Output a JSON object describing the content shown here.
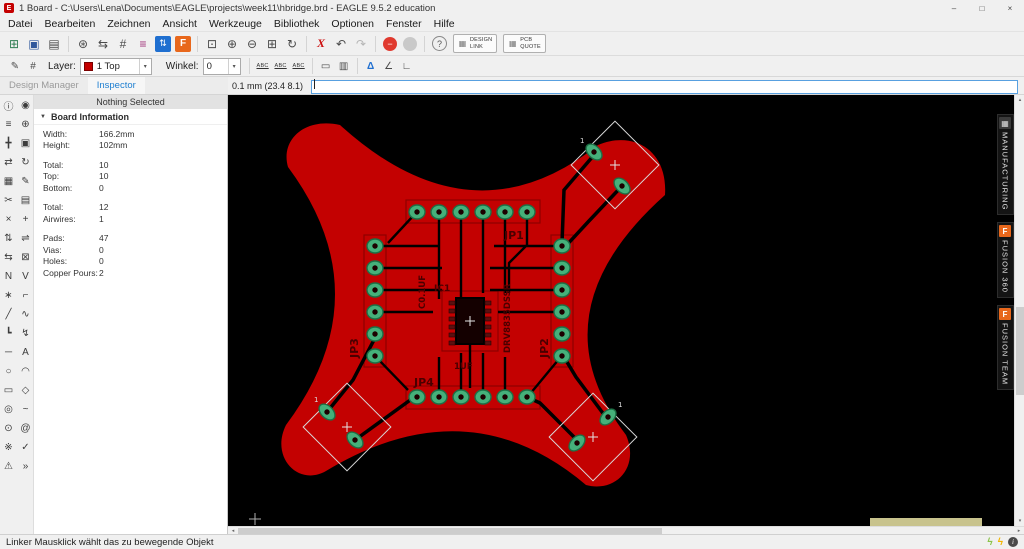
{
  "titlebar": {
    "title": "1 Board - C:\\Users\\Lena\\Documents\\EAGLE\\projects\\week11\\hbridge.brd - EAGLE 9.5.2 education",
    "minimize": "–",
    "maximize": "□",
    "close": "×",
    "app_initial": "E"
  },
  "menubar": {
    "items": [
      "Datei",
      "Bearbeiten",
      "Zeichnen",
      "Ansicht",
      "Werkzeuge",
      "Bibliothek",
      "Optionen",
      "Fenster",
      "Hilfe"
    ]
  },
  "toolbar": {
    "open": "⊞",
    "save": "▣",
    "print": "▤",
    "cam": "⊛",
    "schematic": "⇆",
    "grid": "#",
    "layers": "≡",
    "sync": "⇅",
    "fusion": "F",
    "zoom_fit": "⊡",
    "zoom_in": "⊕",
    "zoom_out": "⊖",
    "zoom_select": "⊞",
    "zoom_redraw": "↻",
    "cancel": "X",
    "undo": "↶",
    "redo": "↷",
    "stop": "−",
    "help": "?",
    "design_link_1": "DESIGN",
    "design_link_2": "LINK",
    "pcb_quote_1": "PCB",
    "pcb_quote_2": "QUOTE",
    "grid_glyph": "▦"
  },
  "parambar": {
    "tool1": "✎",
    "tool2": "#",
    "layer_label": "Layer:",
    "layer_value": "1 Top",
    "angle_label": "Winkel:",
    "angle_value": "0",
    "abc": "ABC",
    "mirror": "▭",
    "spin": "▥",
    "delta": "Δ",
    "angle_icon": "∠",
    "right_angle": "∟",
    "caret": "▾"
  },
  "panel": {
    "tabs": [
      {
        "label": "Design Manager"
      },
      {
        "label": "Inspector"
      }
    ],
    "nothing_selected": "Nothing Selected",
    "section_title": "Board Information",
    "triangle": "▼",
    "rows": [
      {
        "label": "Width:",
        "value": "166.2mm"
      },
      {
        "label": "Height:",
        "value": "102mm"
      },
      {
        "label": "Total:",
        "value": "10"
      },
      {
        "label": "Top:",
        "value": "10"
      },
      {
        "label": "Bottom:",
        "value": "0"
      },
      {
        "label": "Total:",
        "value": "12"
      },
      {
        "label": "Airwires:",
        "value": "1"
      },
      {
        "label": "Pads:",
        "value": "47"
      },
      {
        "label": "Vias:",
        "value": "0"
      },
      {
        "label": "Holes:",
        "value": "0"
      },
      {
        "label": "Copper Pours:",
        "value": "2"
      }
    ]
  },
  "command": {
    "coords": "0.1 mm (23.4 8.1)",
    "value": ""
  },
  "canvas": {
    "labels": {
      "jp1": "JP1",
      "jp2": "JP2",
      "jp3": "JP3",
      "jp4": "JP4",
      "ic": "IC1",
      "ic_value": "DRV8835DSSR",
      "c1": "C0.1UF",
      "c2": "1UF",
      "pin1": "1"
    }
  },
  "right_tabs": [
    {
      "label": "MANUFACTURING",
      "icon": "▦"
    },
    {
      "label": "FUSION 360",
      "icon": "F"
    },
    {
      "label": "FUSION TEAM",
      "icon": "F"
    }
  ],
  "statusbar": {
    "message": "Linker Mausklick wählt das zu bewegende Objekt",
    "bolt": "ϟ",
    "info": "i"
  },
  "scroll": {
    "left": "◂",
    "right": "▸",
    "up": "▴",
    "down": "▾"
  },
  "tools": [
    {
      "name": "info",
      "glyph": "ⓘ"
    },
    {
      "name": "show",
      "glyph": "◉"
    },
    {
      "name": "display",
      "glyph": "≡"
    },
    {
      "name": "mark",
      "glyph": "⊕"
    },
    {
      "name": "move",
      "glyph": "╋"
    },
    {
      "name": "copy",
      "glyph": "▣"
    },
    {
      "name": "mirror",
      "glyph": "⇄"
    },
    {
      "name": "rotate",
      "glyph": "↻"
    },
    {
      "name": "group",
      "glyph": "▦"
    },
    {
      "name": "change",
      "glyph": "✎"
    },
    {
      "name": "cut",
      "glyph": "✂"
    },
    {
      "name": "paste",
      "glyph": "▤"
    },
    {
      "name": "delete",
      "glyph": "×"
    },
    {
      "name": "add",
      "glyph": "+"
    },
    {
      "name": "pinswap",
      "glyph": "⇅"
    },
    {
      "name": "replace",
      "glyph": "⇌"
    },
    {
      "name": "gateswap",
      "glyph": "⇆"
    },
    {
      "name": "lock",
      "glyph": "⊠"
    },
    {
      "name": "name",
      "glyph": "N"
    },
    {
      "name": "value",
      "glyph": "V"
    },
    {
      "name": "smash",
      "glyph": "∗"
    },
    {
      "name": "miter",
      "glyph": "⌐"
    },
    {
      "name": "split",
      "glyph": "╱"
    },
    {
      "name": "optimize",
      "glyph": "∿"
    },
    {
      "name": "route",
      "glyph": "┗"
    },
    {
      "name": "ripup",
      "glyph": "↯"
    },
    {
      "name": "wire",
      "glyph": "─"
    },
    {
      "name": "text",
      "glyph": "A"
    },
    {
      "name": "circle",
      "glyph": "○"
    },
    {
      "name": "arc",
      "glyph": "◠"
    },
    {
      "name": "rect",
      "glyph": "▭"
    },
    {
      "name": "polygon",
      "glyph": "◇"
    },
    {
      "name": "via",
      "glyph": "◎"
    },
    {
      "name": "signal",
      "glyph": "~"
    },
    {
      "name": "hole",
      "glyph": "⊙"
    },
    {
      "name": "attribute",
      "glyph": "@"
    },
    {
      "name": "ratsnest",
      "glyph": "※"
    },
    {
      "name": "drc",
      "glyph": "✓"
    },
    {
      "name": "errors",
      "glyph": "⚠"
    },
    {
      "name": "ulp",
      "glyph": "»"
    }
  ]
}
